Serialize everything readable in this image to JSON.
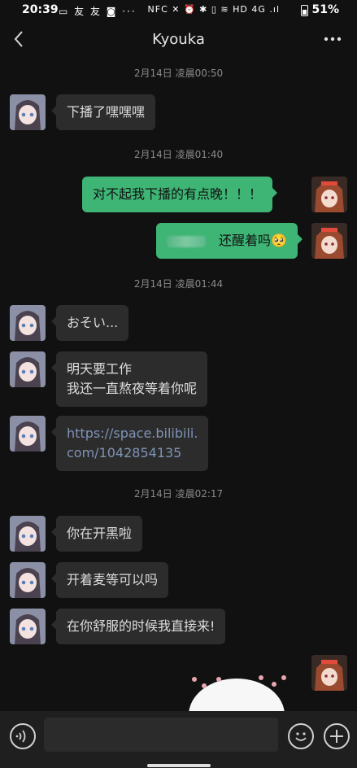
{
  "status": {
    "time": "20:39",
    "left_icons": "▭ 友 友 ◙ ···",
    "right_icons": "NFC ✕ ⏰ ✱ ▯ ≋ HD 4G .ıl",
    "battery": "51%"
  },
  "header": {
    "title": "Kyouka",
    "back_icon": "chevron-left-icon",
    "more_icon": "more-dots-icon"
  },
  "timestamps": [
    "2月14日 凌晨00:50",
    "2月14日 凌晨01:40",
    "2月14日 凌晨01:44",
    "2月14日 凌晨02:17"
  ],
  "messages": [
    {
      "side": "left",
      "text": "下播了嘿嘿嘿"
    },
    {
      "side": "right",
      "text": "对不起我下播的有点晚！！！"
    },
    {
      "side": "right",
      "text": "还醒着吗🥺"
    },
    {
      "side": "left",
      "text": "おそい..."
    },
    {
      "side": "left",
      "text": "明天要工作\n我还一直熬夜等着你呢"
    },
    {
      "side": "left",
      "text": "https://space.bilibili.\ncom/1042854135"
    },
    {
      "side": "left",
      "text": "你在开黑啦"
    },
    {
      "side": "left",
      "text": "开着麦等可以吗"
    },
    {
      "side": "left",
      "text": "在你舒服的时候我直接来!"
    }
  ],
  "input": {
    "placeholder": "",
    "voice_icon": "voice-icon",
    "emoji_icon": "emoji-icon",
    "plus_icon": "plus-icon"
  },
  "colors": {
    "background": "#111111",
    "bubble_left": "#2c2c2c",
    "bubble_right": "#3eb575",
    "link": "#7f93b5"
  }
}
